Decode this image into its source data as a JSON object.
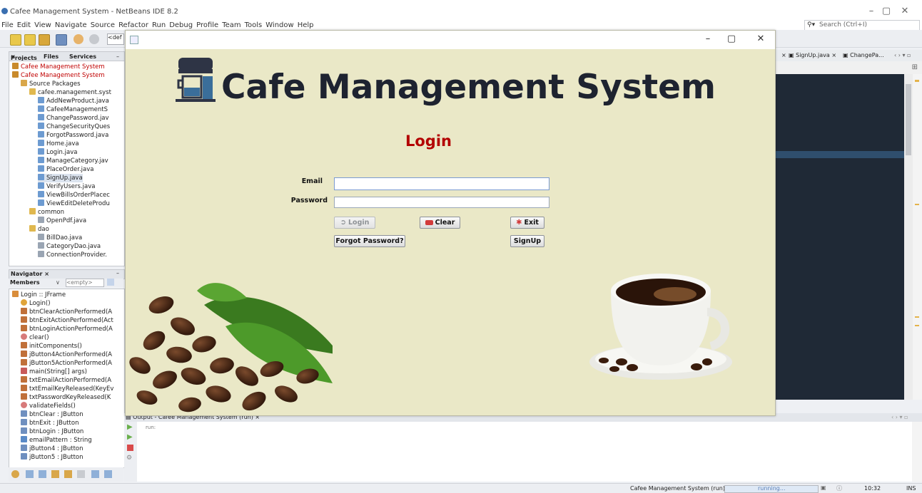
{
  "ide": {
    "title": "Cafee Management System - NetBeans IDE 8.2",
    "menu": [
      "File",
      "Edit",
      "View",
      "Navigate",
      "Source",
      "Refactor",
      "Run",
      "Debug",
      "Profile",
      "Team",
      "Tools",
      "Window",
      "Help"
    ],
    "search_placeholder": "Search (Ctrl+I)",
    "toolbar_config": "<def",
    "projects_tabs": [
      "Projects",
      "Files",
      "Services"
    ],
    "project_tree": [
      {
        "label": "Cafee Management System",
        "depth": 0,
        "kind": "project",
        "color": "#c00000"
      },
      {
        "label": "Cafee Management System",
        "depth": 0,
        "kind": "project",
        "color": "#c00000"
      },
      {
        "label": "Source Packages",
        "depth": 1,
        "kind": "folder"
      },
      {
        "label": "cafee.management.syst",
        "depth": 2,
        "kind": "package"
      },
      {
        "label": "AddNewProduct.java",
        "depth": 3,
        "kind": "java"
      },
      {
        "label": "CafeeManagementS",
        "depth": 3,
        "kind": "java"
      },
      {
        "label": "ChangePassword.jav",
        "depth": 3,
        "kind": "java"
      },
      {
        "label": "ChangeSecurityQues",
        "depth": 3,
        "kind": "java"
      },
      {
        "label": "ForgotPassword.java",
        "depth": 3,
        "kind": "java"
      },
      {
        "label": "Home.java",
        "depth": 3,
        "kind": "java"
      },
      {
        "label": "Login.java",
        "depth": 3,
        "kind": "java"
      },
      {
        "label": "ManageCategory.jav",
        "depth": 3,
        "kind": "java"
      },
      {
        "label": "PlaceOrder.java",
        "depth": 3,
        "kind": "java"
      },
      {
        "label": "SignUp.java",
        "depth": 3,
        "kind": "java",
        "selected": true
      },
      {
        "label": "VerifyUsers.java",
        "depth": 3,
        "kind": "java"
      },
      {
        "label": "ViewBillsOrderPlacec",
        "depth": 3,
        "kind": "java"
      },
      {
        "label": "ViewEditDeleteProdu",
        "depth": 3,
        "kind": "java"
      },
      {
        "label": "common",
        "depth": 2,
        "kind": "package"
      },
      {
        "label": "OpenPdf.java",
        "depth": 3,
        "kind": "class"
      },
      {
        "label": "dao",
        "depth": 2,
        "kind": "package"
      },
      {
        "label": "BillDao.java",
        "depth": 3,
        "kind": "class"
      },
      {
        "label": "CategoryDao.java",
        "depth": 3,
        "kind": "class"
      },
      {
        "label": "ConnectionProvider.",
        "depth": 3,
        "kind": "class"
      }
    ],
    "navigator_title": "Navigator",
    "navigator_members": "Members",
    "navigator_filter": "<empty>",
    "navigator_tree": [
      {
        "label": "Login :: JFrame",
        "depth": 0,
        "kind": "frame"
      },
      {
        "label": "Login()",
        "depth": 1,
        "kind": "ctor"
      },
      {
        "label": "btnClearActionPerformed(A",
        "depth": 1,
        "kind": "method"
      },
      {
        "label": "btnExitActionPerformed(Act",
        "depth": 1,
        "kind": "method"
      },
      {
        "label": "btnLoginActionPerformed(A",
        "depth": 1,
        "kind": "method"
      },
      {
        "label": "clear()",
        "depth": 1,
        "kind": "private"
      },
      {
        "label": "initComponents()",
        "depth": 1,
        "kind": "method"
      },
      {
        "label": "jButton4ActionPerformed(A",
        "depth": 1,
        "kind": "method"
      },
      {
        "label": "jButton5ActionPerformed(A",
        "depth": 1,
        "kind": "method"
      },
      {
        "label": "main(String[] args)",
        "depth": 1,
        "kind": "static"
      },
      {
        "label": "txtEmailActionPerformed(A",
        "depth": 1,
        "kind": "method"
      },
      {
        "label": "txtEmailKeyReleased(KeyEv",
        "depth": 1,
        "kind": "method"
      },
      {
        "label": "txtPasswordKeyReleased(K",
        "depth": 1,
        "kind": "method"
      },
      {
        "label": "validateFields()",
        "depth": 1,
        "kind": "private"
      },
      {
        "label": "btnClear : JButton",
        "depth": 1,
        "kind": "field"
      },
      {
        "label": "btnExit : JButton",
        "depth": 1,
        "kind": "field"
      },
      {
        "label": "btnLogin : JButton",
        "depth": 1,
        "kind": "field"
      },
      {
        "label": "emailPattern : String",
        "depth": 1,
        "kind": "string"
      },
      {
        "label": "jButton4 : JButton",
        "depth": 1,
        "kind": "field"
      },
      {
        "label": "jButton5 : JButton",
        "depth": 1,
        "kind": "field"
      }
    ],
    "editor_tabs": [
      "SignUp.java",
      "ChangePa..."
    ],
    "output_title": "Output - Cafee Management System (run)",
    "output_text": "run:",
    "status_project": "Cafee Management System (run)",
    "status_running": "running...",
    "status_time": "10:32",
    "status_mode": "INS"
  },
  "login_window": {
    "banner_title": "Cafe Management System",
    "heading": "Login",
    "email_label": "Email",
    "email_value": "",
    "password_label": "Password",
    "password_value": "",
    "buttons": {
      "login": "Login",
      "clear": "Clear",
      "exit": "Exit",
      "forgot": "Forgot Password?",
      "signup": "SignUp"
    },
    "login_enabled": false
  },
  "icons": {
    "logo": "coffee-machine-icon",
    "login_button": "login-arrow-icon",
    "clear_button": "eraser-icon",
    "exit_button": "exit-person-icon"
  }
}
